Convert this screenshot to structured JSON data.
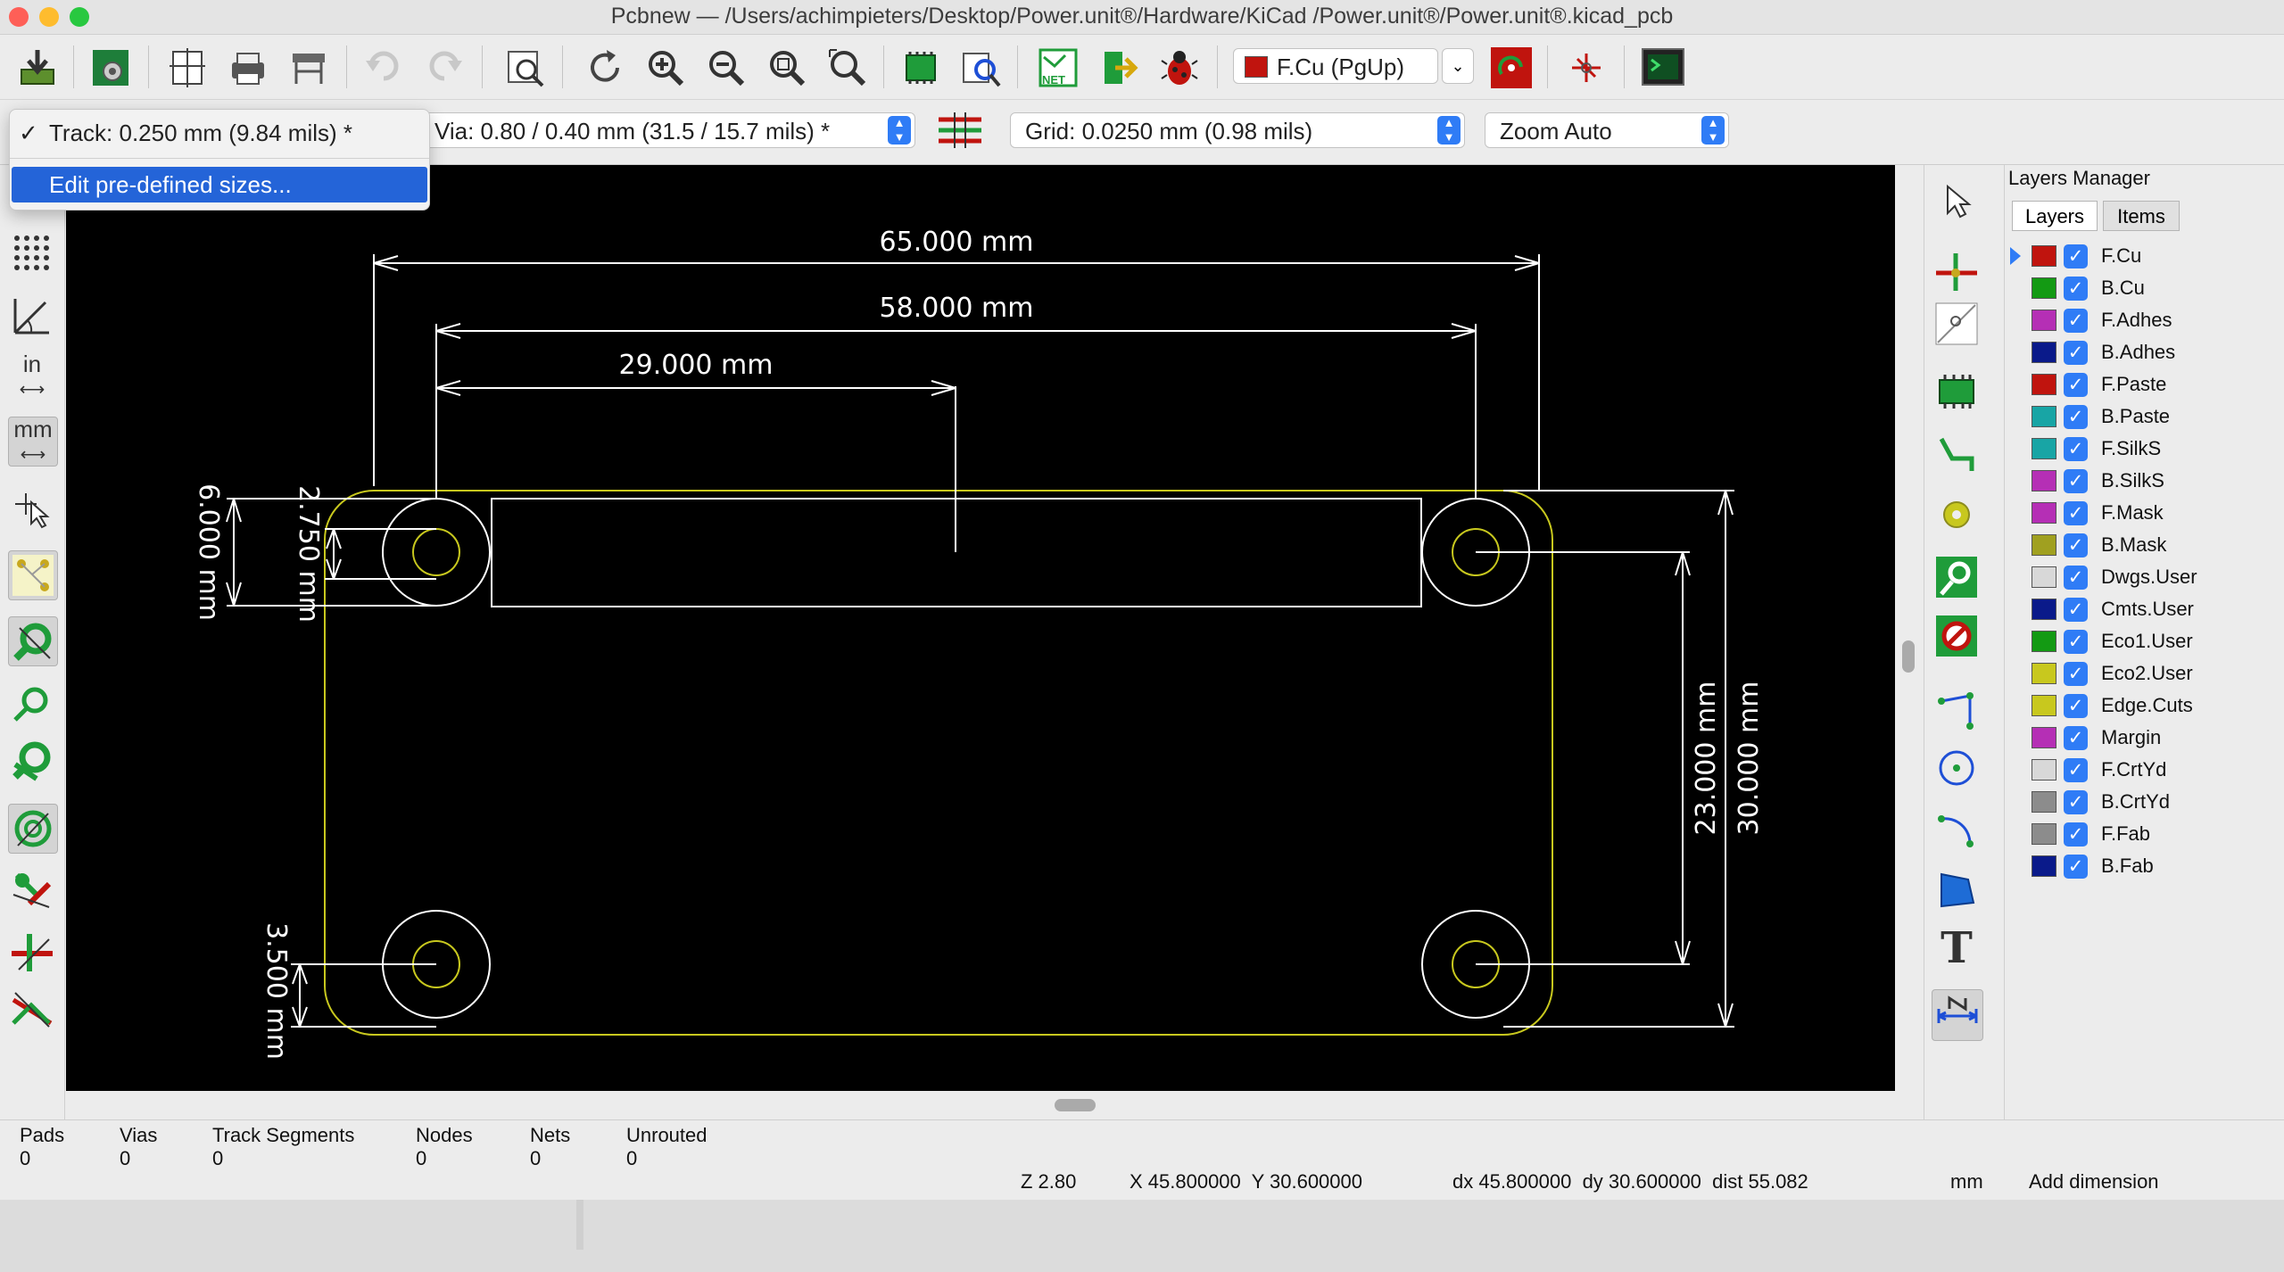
{
  "window": {
    "title": "Pcbnew — /Users/achimpieters/Desktop/Power.unit®/Hardware/KiCad /Power.unit®/Power.unit®.kicad_pcb"
  },
  "toolbar": {
    "layer_select": "F.Cu (PgUp)",
    "layer_color": "#c0140e"
  },
  "options_bar": {
    "track_selected": "Track: 0.250 mm (9.84 mils) *",
    "via": "Via: 0.80 / 0.40 mm (31.5 / 15.7 mils) *",
    "grid": "Grid: 0.0250 mm (0.98 mils)",
    "zoom": "Zoom Auto"
  },
  "track_menu": {
    "check": "✓",
    "item_checked": "Track: 0.250 mm (9.84 mils) *",
    "item_highlighted": "Edit pre-defined sizes..."
  },
  "canvas": {
    "dimensions": {
      "d65": "65.000 mm",
      "d58": "58.000 mm",
      "d29": "29.000 mm",
      "d6": "6.000 mm",
      "d2750": "2.750 mm",
      "d3500": "3.500 mm",
      "d23": "23.000 mm",
      "d30": "30.000 mm"
    }
  },
  "left_toolbar": {
    "units_in": "in",
    "units_mm": "mm"
  },
  "right_toolbar": {
    "text_tool": "T"
  },
  "layers_manager": {
    "title": "Layers Manager",
    "tabs": [
      "Layers",
      "Items"
    ],
    "layers": [
      {
        "name": "F.Cu",
        "color": "#c0140e"
      },
      {
        "name": "B.Cu",
        "color": "#139a13"
      },
      {
        "name": "F.Adhes",
        "color": "#b52fb5"
      },
      {
        "name": "B.Adhes",
        "color": "#0a1a8a"
      },
      {
        "name": "F.Paste",
        "color": "#c0140e"
      },
      {
        "name": "B.Paste",
        "color": "#18a5a5"
      },
      {
        "name": "F.SilkS",
        "color": "#18a5a5"
      },
      {
        "name": "B.SilkS",
        "color": "#b52fb5"
      },
      {
        "name": "F.Mask",
        "color": "#b52fb5"
      },
      {
        "name": "B.Mask",
        "color": "#a0a020"
      },
      {
        "name": "Dwgs.User",
        "color": "#d8d8d8"
      },
      {
        "name": "Cmts.User",
        "color": "#0a1a8a"
      },
      {
        "name": "Eco1.User",
        "color": "#139a13"
      },
      {
        "name": "Eco2.User",
        "color": "#c8c81e"
      },
      {
        "name": "Edge.Cuts",
        "color": "#c8c81e"
      },
      {
        "name": "Margin",
        "color": "#b52fb5"
      },
      {
        "name": "F.CrtYd",
        "color": "#d8d8d8"
      },
      {
        "name": "B.CrtYd",
        "color": "#8c8c8c"
      },
      {
        "name": "F.Fab",
        "color": "#8c8c8c"
      },
      {
        "name": "B.Fab",
        "color": "#0a1a8a"
      }
    ]
  },
  "status_bar": {
    "pads_label": "Pads",
    "pads_value": "0",
    "vias_label": "Vias",
    "vias_value": "0",
    "tracks_label": "Track Segments",
    "tracks_value": "0",
    "nodes_label": "Nodes",
    "nodes_value": "0",
    "nets_label": "Nets",
    "nets_value": "0",
    "unrouted_label": "Unrouted",
    "unrouted_value": "0",
    "zoom": "Z 2.80",
    "xy": "X 45.800000  Y 30.600000",
    "delta": "dx 45.800000  dy 30.600000  dist 55.082",
    "units": "mm",
    "mode": "Add dimension"
  }
}
